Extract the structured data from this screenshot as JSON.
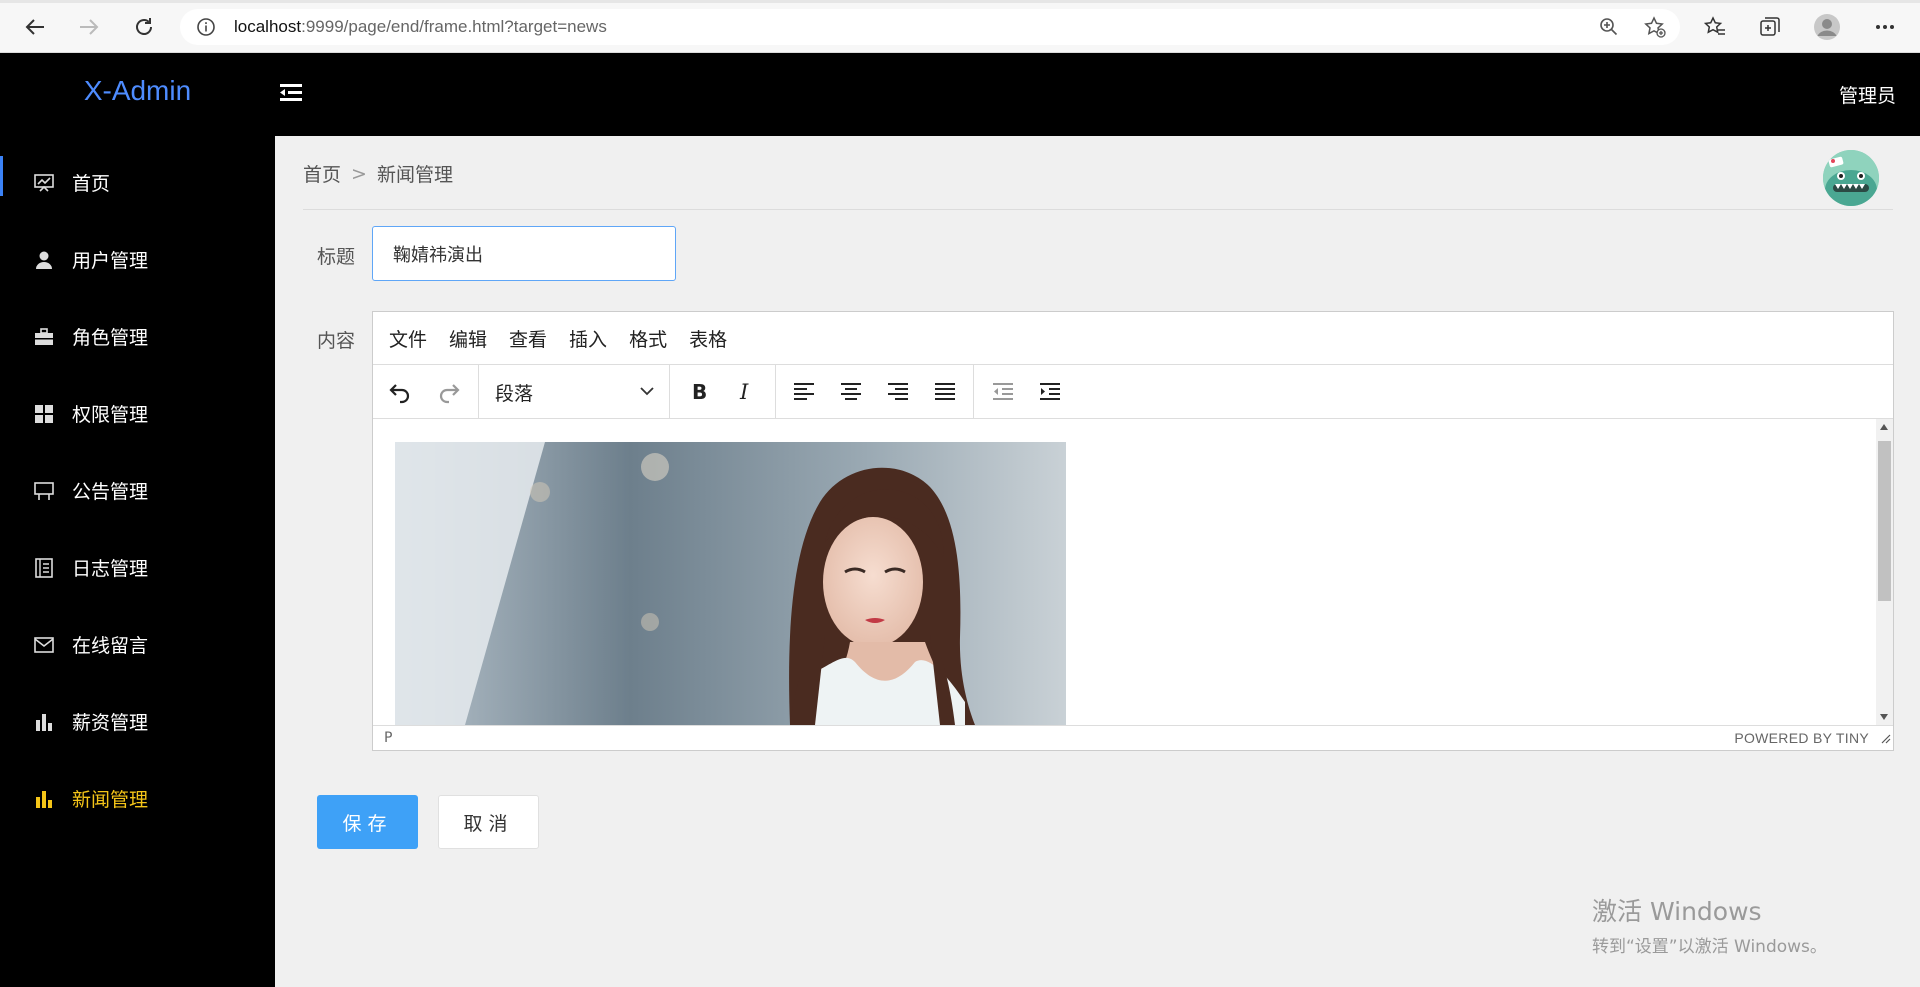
{
  "browser": {
    "url_host": "localhost",
    "url_rest": ":9999/page/end/frame.html?target=news",
    "icons": [
      "back-icon",
      "forward-icon",
      "refresh-icon",
      "info-icon",
      "zoom-icon",
      "add-favorite-icon",
      "favorites-icon",
      "collections-icon",
      "profile-icon",
      "more-icon"
    ]
  },
  "sidebar": {
    "logo": "X-Admin",
    "items": [
      {
        "label": "首页",
        "icon": "dashboard-icon"
      },
      {
        "label": "用户管理",
        "icon": "user-icon"
      },
      {
        "label": "角色管理",
        "icon": "briefcase-icon"
      },
      {
        "label": "权限管理",
        "icon": "grid-icon"
      },
      {
        "label": "公告管理",
        "icon": "board-icon"
      },
      {
        "label": "日志管理",
        "icon": "log-icon"
      },
      {
        "label": "在线留言",
        "icon": "mail-icon"
      },
      {
        "label": "薪资管理",
        "icon": "bar-chart-icon"
      },
      {
        "label": "新闻管理",
        "icon": "bar-chart-icon"
      }
    ],
    "active_index": 8,
    "active_color": "#f5c518"
  },
  "header": {
    "admin": "管理员"
  },
  "breadcrumb": {
    "home": "首页",
    "sep": ">",
    "current": "新闻管理"
  },
  "form": {
    "title_label": "标题",
    "title_value": "鞠婧祎演出",
    "content_label": "内容",
    "save": "保存",
    "cancel": "取消"
  },
  "editor": {
    "menus": [
      "文件",
      "编辑",
      "查看",
      "插入",
      "格式",
      "表格"
    ],
    "block_format": "段落",
    "status_path": "P",
    "powered_by": "POWERED BY TINY"
  },
  "watermark": {
    "line1": "激活 Windows",
    "line2": "转到“设置”以激活 Windows。"
  },
  "colors": {
    "accent": "#3ea1f7",
    "logo": "#4e8cff",
    "sidebar_bg": "#000000"
  }
}
